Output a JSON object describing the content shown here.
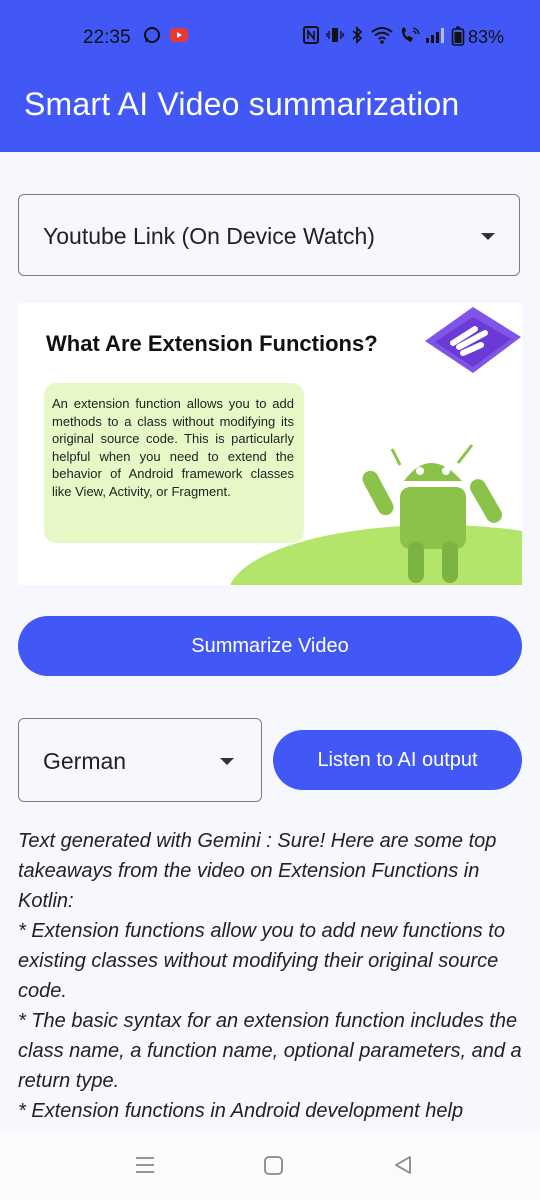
{
  "status_bar": {
    "time": "22:35",
    "battery": "83%",
    "icons": [
      "whatsapp-icon",
      "youtube-icon",
      "nfc-icon",
      "vibrate-icon",
      "bluetooth-icon",
      "wifi-icon",
      "call-icon",
      "signal-icon",
      "battery-icon"
    ]
  },
  "app_bar": {
    "title": "Smart AI Video summarization"
  },
  "source_dropdown": {
    "selected": "Youtube Link (On Device Watch)"
  },
  "thumbnail": {
    "title": "What Are Extension Functions?",
    "body": "An extension function allows you to add methods to a class without modifying its original source code. This is particularly helpful when you need to extend the behavior of Android framework classes like View, Activity, or Fragment.",
    "colors": {
      "box": "#e7f8c7",
      "hill": "#b3e56a",
      "android": "#8bc34a",
      "logo": "#6a39d6"
    }
  },
  "summarize_button": {
    "label": "Summarize Video"
  },
  "language_dropdown": {
    "selected": "German"
  },
  "listen_button": {
    "label": "Listen to AI output"
  },
  "output": {
    "lines": [
      "Text generated with Gemini : Sure! Here are some top takeaways from the video on Extension Functions in Kotlin:",
      "*  Extension functions allow you to add new functions to existing classes without modifying their original source code.",
      "*  The basic syntax for an extension function includes the class name, a function name, optional parameters, and a return type.",
      "*  Extension functions in Android development help"
    ]
  },
  "nav_bar": {
    "icons": [
      "recents-icon",
      "home-icon",
      "back-icon"
    ]
  },
  "colors": {
    "primary": "#4158f6",
    "background": "#f6f8fd"
  }
}
